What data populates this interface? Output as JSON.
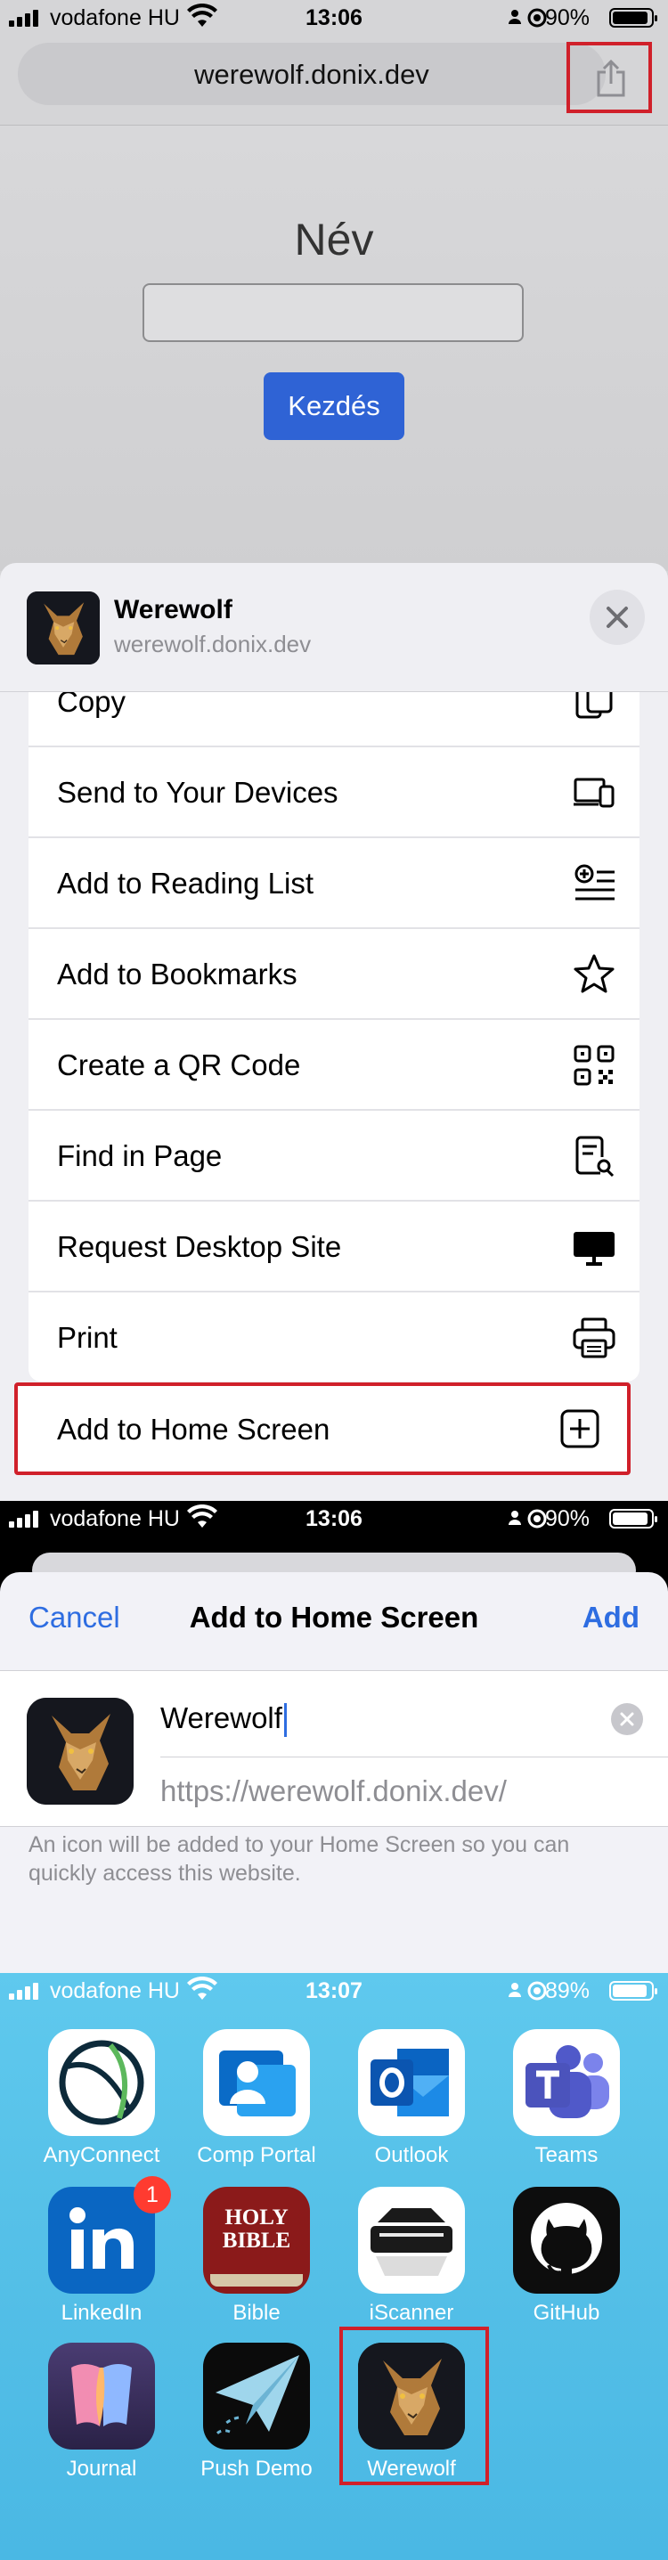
{
  "panel1": {
    "status": {
      "carrier": "vodafone HU",
      "time": "13:06",
      "battery": "90%",
      "battery_level": 0.9
    },
    "url": "werewolf.donix.dev",
    "page": {
      "name_label": "Név",
      "start_button": "Kezdés"
    },
    "share_sheet": {
      "title": "Werewolf",
      "subtitle": "werewolf.donix.dev",
      "items": [
        {
          "label": "Copy",
          "icon": "copy-icon"
        },
        {
          "label": "Send to Your Devices",
          "icon": "devices-icon"
        },
        {
          "label": "Add to Reading List",
          "icon": "reading-list-icon"
        },
        {
          "label": "Add to Bookmarks",
          "icon": "star-icon"
        },
        {
          "label": "Create a QR Code",
          "icon": "qr-code-icon"
        },
        {
          "label": "Find in Page",
          "icon": "find-in-page-icon"
        },
        {
          "label": "Request Desktop Site",
          "icon": "desktop-icon"
        },
        {
          "label": "Print",
          "icon": "printer-icon"
        }
      ],
      "home_screen": {
        "label": "Add to Home Screen",
        "icon": "plus-square-icon"
      }
    }
  },
  "panel2": {
    "status": {
      "carrier": "vodafone HU",
      "time": "13:06",
      "battery": "90%",
      "battery_level": 0.9
    },
    "cancel": "Cancel",
    "title": "Add to Home Screen",
    "add": "Add",
    "name_value": "Werewolf",
    "url_value": "https://werewolf.donix.dev/",
    "note": "An icon will be added to your Home Screen so you can quickly access this website."
  },
  "panel3": {
    "status": {
      "carrier": "vodafone HU",
      "time": "13:07",
      "battery": "89%",
      "battery_level": 0.89
    },
    "apps": [
      {
        "name": "AnyConnect",
        "icon": "anyconnect-icon"
      },
      {
        "name": "Comp Portal",
        "icon": "comp-portal-icon"
      },
      {
        "name": "Outlook",
        "icon": "outlook-icon"
      },
      {
        "name": "Teams",
        "icon": "teams-icon"
      },
      {
        "name": "LinkedIn",
        "icon": "linkedin-icon",
        "badge": "1"
      },
      {
        "name": "Bible",
        "icon": "bible-icon",
        "tile_text": "HOLY BIBLE"
      },
      {
        "name": "iScanner",
        "icon": "scanner-icon"
      },
      {
        "name": "GitHub",
        "icon": "github-icon"
      },
      {
        "name": "Journal",
        "icon": "journal-icon"
      },
      {
        "name": "Push Demo",
        "icon": "paper-plane-icon"
      },
      {
        "name": "Werewolf",
        "icon": "werewolf-icon"
      }
    ]
  },
  "colors": {
    "accent": "#2e6de1",
    "highlight": "#d0202a",
    "button": "#2f63d5",
    "homescreen": "#56c1e8"
  }
}
